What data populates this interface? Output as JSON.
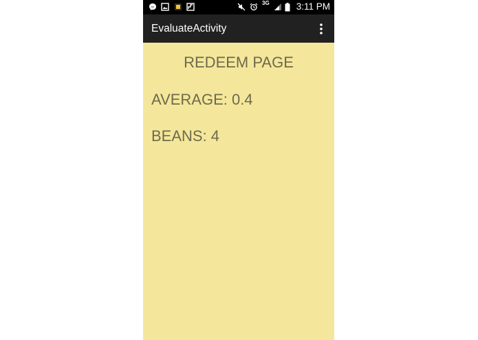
{
  "status_bar": {
    "network_label": "3G",
    "time": "3:11 PM",
    "icons": [
      "messenger-icon",
      "gallery-icon",
      "notification-icon",
      "photo-icon",
      "mute-icon",
      "alarm-icon",
      "signal-icon",
      "battery-icon"
    ]
  },
  "action_bar": {
    "title": "EvaluateActivity",
    "overflow_icon": "more-vert-icon"
  },
  "content": {
    "heading": "REDEEM PAGE",
    "average": "AVERAGE: 0.4",
    "beans": "BEANS: 4"
  },
  "colors": {
    "status_bar": "#000000",
    "action_bar": "#212121",
    "background": "#f4e79b",
    "text": "#6e6a4c"
  }
}
